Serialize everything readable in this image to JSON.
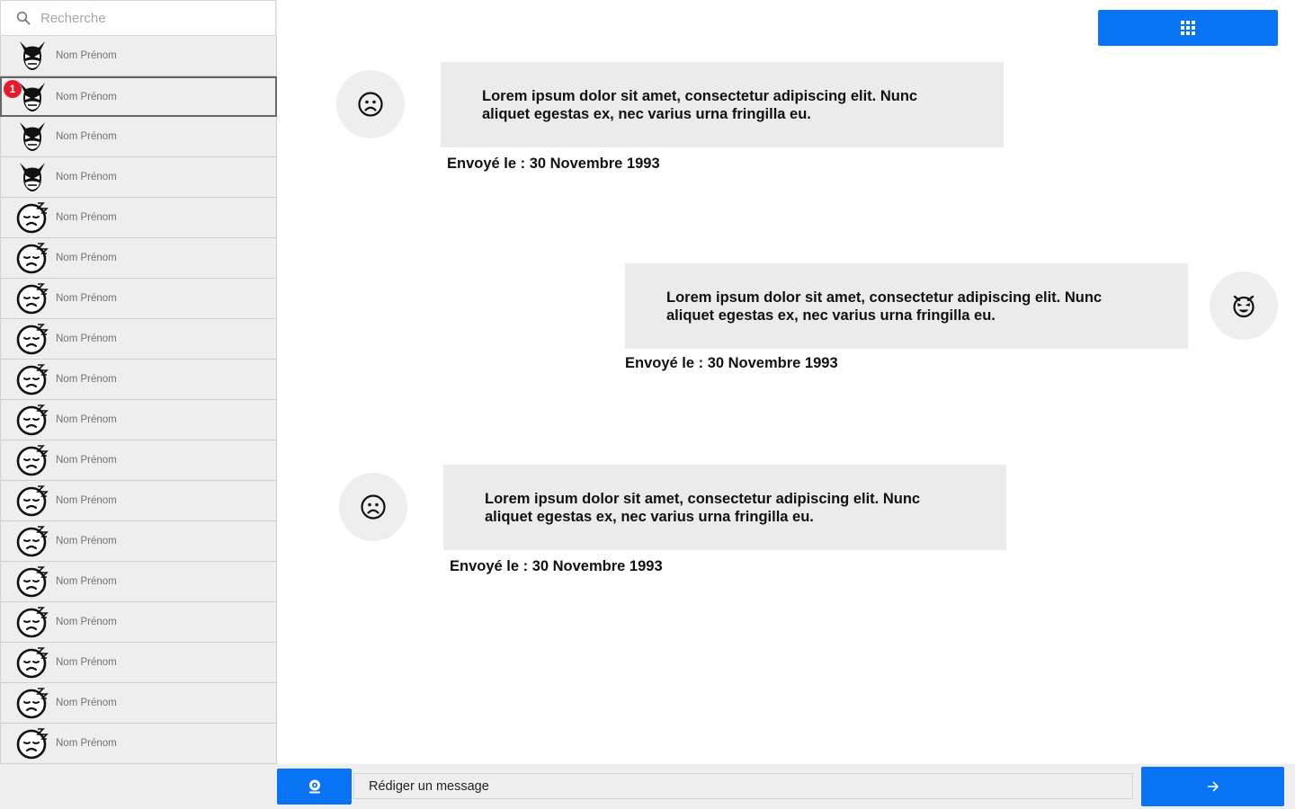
{
  "search": {
    "placeholder": "Recherche",
    "icon": "search-icon"
  },
  "contacts": [
    {
      "name": "Nom Prénom",
      "avatar": "wolverine-icon",
      "active": false,
      "badge": ""
    },
    {
      "name": "Nom Prénom",
      "avatar": "wolverine-icon",
      "active": true,
      "badge": "1"
    },
    {
      "name": "Nom Prénom",
      "avatar": "wolverine-icon",
      "active": false,
      "badge": ""
    },
    {
      "name": "Nom Prénom",
      "avatar": "wolverine-icon",
      "active": false,
      "badge": ""
    },
    {
      "name": "Nom Prénom",
      "avatar": "sleeping-face-icon",
      "active": false,
      "badge": ""
    },
    {
      "name": "Nom Prénom",
      "avatar": "sleeping-face-icon",
      "active": false,
      "badge": ""
    },
    {
      "name": "Nom Prénom",
      "avatar": "sleeping-face-icon",
      "active": false,
      "badge": ""
    },
    {
      "name": "Nom Prénom",
      "avatar": "sleeping-face-icon",
      "active": false,
      "badge": ""
    },
    {
      "name": "Nom Prénom",
      "avatar": "sleeping-face-icon",
      "active": false,
      "badge": ""
    },
    {
      "name": "Nom Prénom",
      "avatar": "sleeping-face-icon",
      "active": false,
      "badge": ""
    },
    {
      "name": "Nom Prénom",
      "avatar": "sleeping-face-icon",
      "active": false,
      "badge": ""
    },
    {
      "name": "Nom Prénom",
      "avatar": "sleeping-face-icon",
      "active": false,
      "badge": ""
    },
    {
      "name": "Nom Prénom",
      "avatar": "sleeping-face-icon",
      "active": false,
      "badge": ""
    },
    {
      "name": "Nom Prénom",
      "avatar": "sleeping-face-icon",
      "active": false,
      "badge": ""
    },
    {
      "name": "Nom Prénom",
      "avatar": "sleeping-face-icon",
      "active": false,
      "badge": ""
    },
    {
      "name": "Nom Prénom",
      "avatar": "sleeping-face-icon",
      "active": false,
      "badge": ""
    },
    {
      "name": "Nom Prénom",
      "avatar": "sleeping-face-icon",
      "active": false,
      "badge": ""
    },
    {
      "name": "Nom Prénom",
      "avatar": "sleeping-face-icon",
      "active": false,
      "badge": ""
    }
  ],
  "messages": [
    {
      "text": "Lorem ipsum dolor sit amet, consectetur adipiscing elit. Nunc aliquet egestas ex, nec varius urna fringilla eu.",
      "sent": "Envoyé le : 30 Novembre 1993",
      "avatar": "frowning-face-icon",
      "direction": "received"
    },
    {
      "text": "Lorem ipsum dolor sit amet, consectetur adipiscing elit. Nunc aliquet egestas ex, nec varius urna fringilla eu.",
      "sent": "Envoyé le : 30 Novembre 1993",
      "avatar": "devil-face-icon",
      "direction": "sent"
    },
    {
      "text": "Lorem ipsum dolor sit amet, consectetur adipiscing elit. Nunc aliquet egestas ex, nec varius urna fringilla eu.",
      "sent": "Envoyé le : 30 Novembre 1993",
      "avatar": "frowning-face-icon",
      "direction": "received"
    }
  ],
  "toolbar": {
    "apps_icon": "grid-icon"
  },
  "composer": {
    "placeholder": "Rédiger un message",
    "camera_icon": "webcam-icon",
    "send_icon": "arrow-right-icon"
  },
  "colors": {
    "accent": "#0874f5",
    "badge": "#e8192c",
    "panel": "#eeeeee",
    "bubble": "#ebebeb"
  }
}
